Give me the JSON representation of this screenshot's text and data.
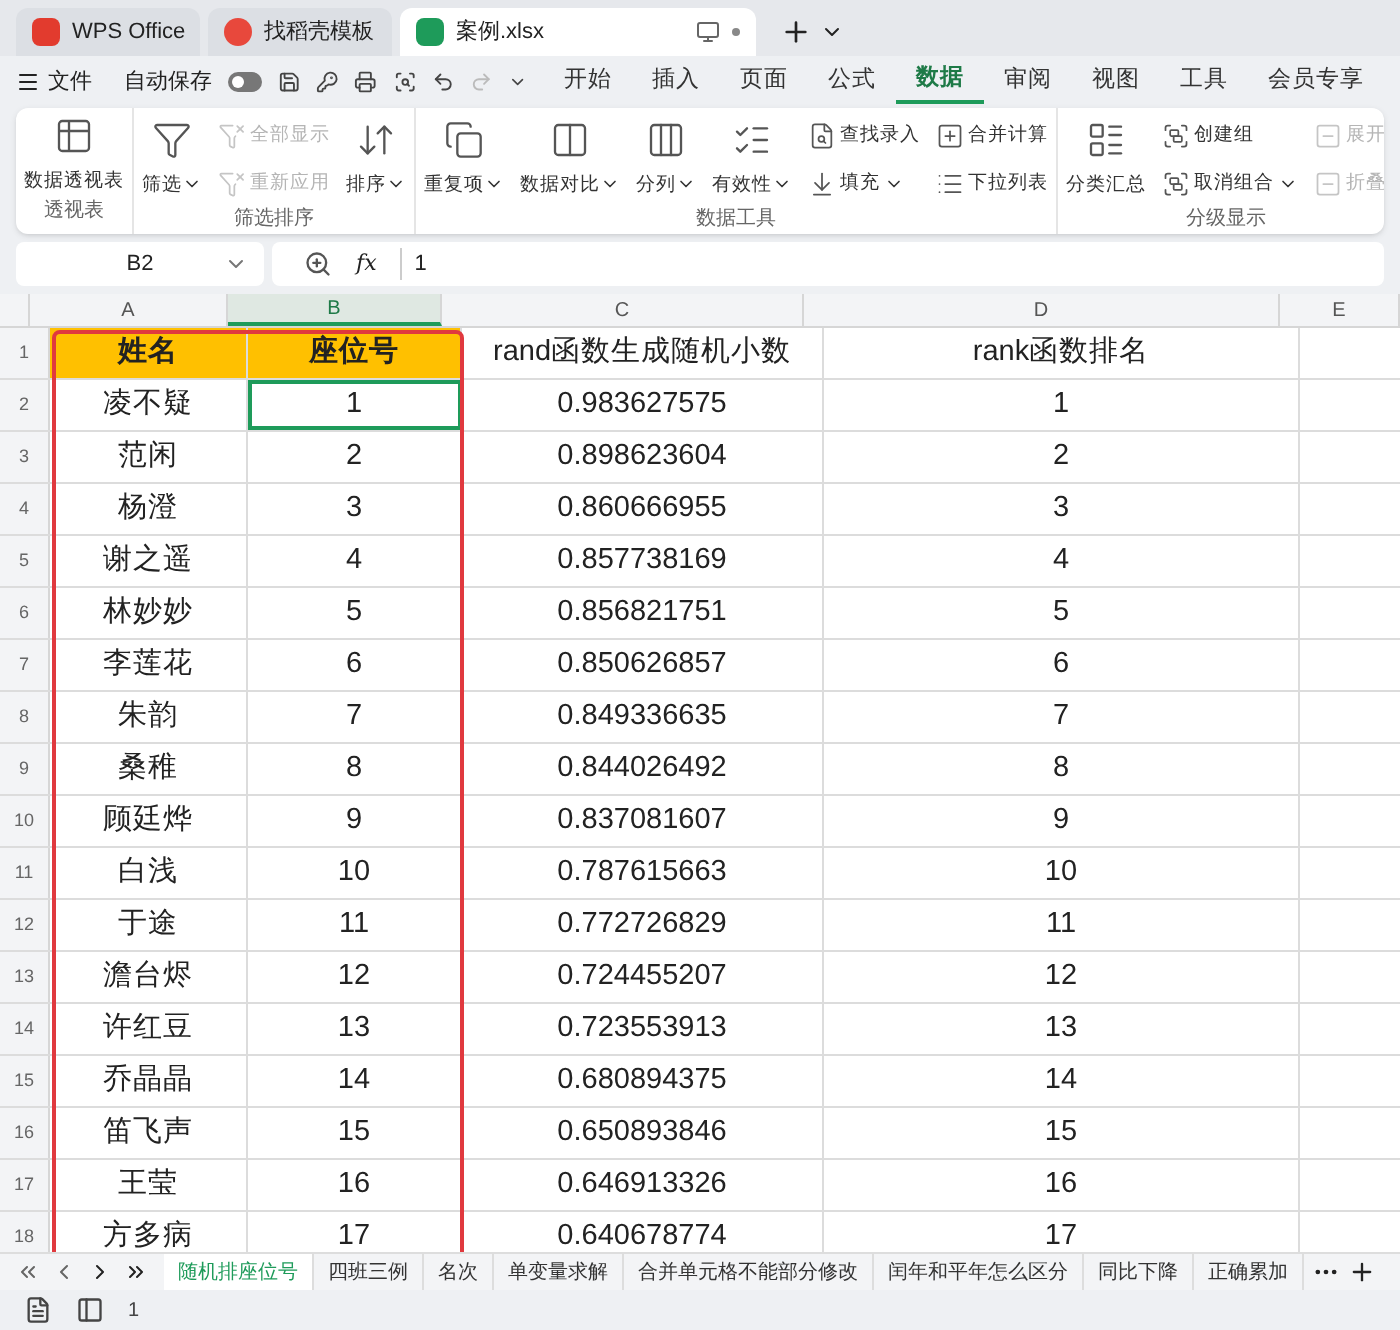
{
  "app_tabs": [
    {
      "label": "WPS Office",
      "kind": "wps",
      "selected": false
    },
    {
      "label": "找稻壳模板",
      "kind": "docer",
      "selected": false
    },
    {
      "label": "案例.xlsx",
      "kind": "sheet",
      "selected": true
    }
  ],
  "menu": {
    "file": "文件",
    "autosave": "自动保存",
    "autosave_on": false,
    "items": [
      {
        "label": "开始",
        "selected": false
      },
      {
        "label": "插入",
        "selected": false
      },
      {
        "label": "页面",
        "selected": false
      },
      {
        "label": "公式",
        "selected": false
      },
      {
        "label": "数据",
        "selected": true
      },
      {
        "label": "审阅",
        "selected": false
      },
      {
        "label": "视图",
        "selected": false
      },
      {
        "label": "工具",
        "selected": false
      },
      {
        "label": "会员专享",
        "selected": false
      }
    ]
  },
  "ribbon": [
    {
      "title": "透视表",
      "columns": [
        [
          {
            "label": "数据透视表",
            "kind": "big",
            "disabled": false
          }
        ]
      ]
    },
    {
      "title": "筛选排序",
      "columns": [
        [
          {
            "label": "筛选",
            "kind": "big",
            "dropdown": true,
            "disabled": false
          }
        ],
        [
          {
            "label": "全部显示",
            "kind": "small",
            "disabled": true
          },
          {
            "label": "重新应用",
            "kind": "small",
            "disabled": true
          }
        ],
        [
          {
            "label": "排序",
            "kind": "big",
            "dropdown": true,
            "disabled": false
          }
        ]
      ]
    },
    {
      "title": "数据工具",
      "columns": [
        [
          {
            "label": "重复项",
            "kind": "big",
            "dropdown": true,
            "disabled": false
          }
        ],
        [
          {
            "label": "数据对比",
            "kind": "big",
            "dropdown": true,
            "disabled": false
          }
        ],
        [
          {
            "label": "分列",
            "kind": "big",
            "dropdown": true,
            "disabled": false
          }
        ],
        [
          {
            "label": "有效性",
            "kind": "big",
            "dropdown": true,
            "disabled": false
          }
        ],
        [
          {
            "label": "查找录入",
            "kind": "small",
            "disabled": false
          },
          {
            "label": "填充",
            "kind": "small",
            "dropdown": true,
            "disabled": false
          }
        ],
        [
          {
            "label": "合并计算",
            "kind": "small",
            "disabled": false
          },
          {
            "label": "下拉列表",
            "kind": "small",
            "disabled": false
          }
        ]
      ]
    },
    {
      "title": "分级显示",
      "columns": [
        [
          {
            "label": "分类汇总",
            "kind": "big",
            "disabled": false
          }
        ],
        [
          {
            "label": "创建组",
            "kind": "small",
            "disabled": false
          },
          {
            "label": "取消组合",
            "kind": "small",
            "dropdown": true,
            "disabled": false
          }
        ],
        [
          {
            "label": "展开",
            "kind": "small",
            "disabled": true
          },
          {
            "label": "折叠",
            "kind": "small",
            "disabled": true
          }
        ]
      ]
    }
  ],
  "formula_bar": {
    "cell": "B2",
    "fx": "fx",
    "value": "1"
  },
  "columns": [
    {
      "label": "A",
      "selected": false
    },
    {
      "label": "B",
      "selected": true
    },
    {
      "label": "C",
      "selected": false
    },
    {
      "label": "D",
      "selected": false
    },
    {
      "label": "E",
      "selected": false
    }
  ],
  "rows": [
    {
      "num": "1",
      "cells": [
        "姓名",
        "座位号",
        "rand函数生成随机小数",
        "rank函数排名"
      ]
    },
    {
      "num": "2",
      "cells": [
        "凌不疑",
        "1",
        "0.983627575",
        "1"
      ]
    },
    {
      "num": "3",
      "cells": [
        "范闲",
        "2",
        "0.898623604",
        "2"
      ]
    },
    {
      "num": "4",
      "cells": [
        "杨澄",
        "3",
        "0.860666955",
        "3"
      ]
    },
    {
      "num": "5",
      "cells": [
        "谢之遥",
        "4",
        "0.857738169",
        "4"
      ]
    },
    {
      "num": "6",
      "cells": [
        "林妙妙",
        "5",
        "0.856821751",
        "5"
      ]
    },
    {
      "num": "7",
      "cells": [
        "李莲花",
        "6",
        "0.850626857",
        "6"
      ]
    },
    {
      "num": "8",
      "cells": [
        "朱韵",
        "7",
        "0.849336635",
        "7"
      ]
    },
    {
      "num": "9",
      "cells": [
        "桑稚",
        "8",
        "0.844026492",
        "8"
      ]
    },
    {
      "num": "10",
      "cells": [
        "顾廷烨",
        "9",
        "0.837081607",
        "9"
      ]
    },
    {
      "num": "11",
      "cells": [
        "白浅",
        "10",
        "0.787615663",
        "10"
      ]
    },
    {
      "num": "12",
      "cells": [
        "于途",
        "11",
        "0.772726829",
        "11"
      ]
    },
    {
      "num": "13",
      "cells": [
        "澹台烬",
        "12",
        "0.724455207",
        "12"
      ]
    },
    {
      "num": "14",
      "cells": [
        "许红豆",
        "13",
        "0.723553913",
        "13"
      ]
    },
    {
      "num": "15",
      "cells": [
        "乔晶晶",
        "14",
        "0.680894375",
        "14"
      ]
    },
    {
      "num": "16",
      "cells": [
        "笛飞声",
        "15",
        "0.650893846",
        "15"
      ]
    },
    {
      "num": "17",
      "cells": [
        "王莹",
        "16",
        "0.646913326",
        "16"
      ]
    },
    {
      "num": "18",
      "cells": [
        "方多病",
        "17",
        "0.640678774",
        "17"
      ]
    }
  ],
  "sheet_tabs": [
    {
      "label": "随机排座位号",
      "selected": true
    },
    {
      "label": "四班三例",
      "selected": false
    },
    {
      "label": "名次",
      "selected": false
    },
    {
      "label": "单变量求解",
      "selected": false
    },
    {
      "label": "合并单元格不能部分修改",
      "selected": false
    },
    {
      "label": "闰年和平年怎么区分",
      "selected": false
    },
    {
      "label": "同比下降",
      "selected": false
    },
    {
      "label": "正确累加",
      "selected": false
    }
  ],
  "status_bar": {
    "count": "1"
  }
}
